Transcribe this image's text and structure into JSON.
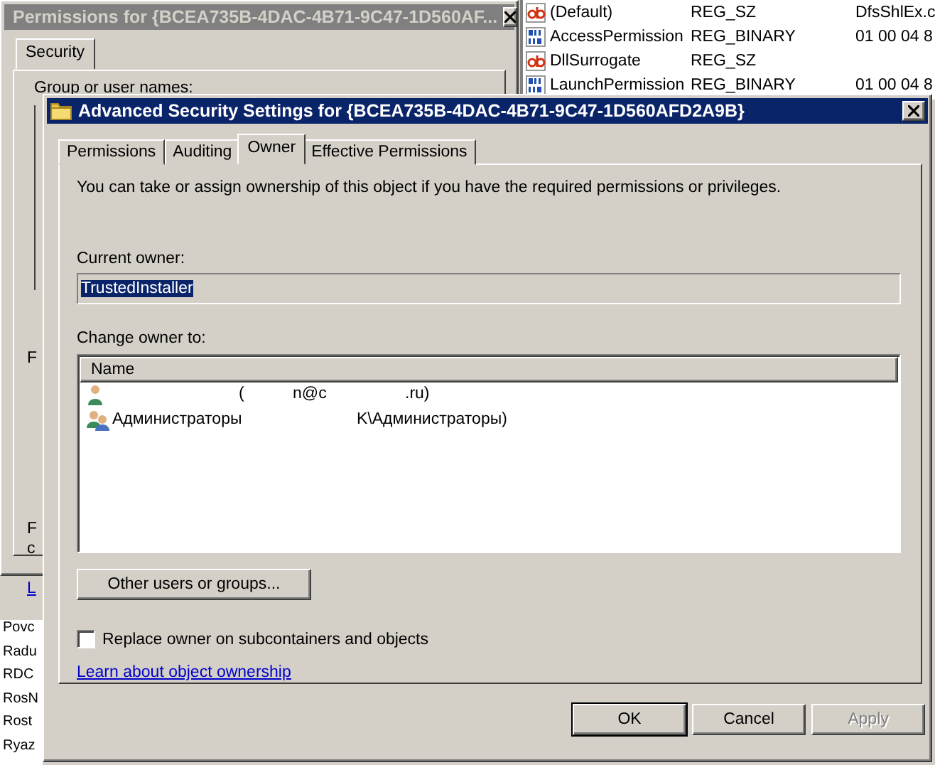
{
  "permissions_window": {
    "title": "Permissions for {BCEA735B-4DAC-4B71-9C47-1D560AF...",
    "tabs": [
      {
        "label": "Security",
        "selected": true
      }
    ],
    "group_label": "Group or user names:",
    "fragments": [
      {
        "kind": "text",
        "text": "F"
      },
      {
        "kind": "text",
        "text": "F"
      },
      {
        "kind": "text",
        "text": "c"
      },
      {
        "kind": "link",
        "text": "L"
      }
    ]
  },
  "registry_values": [
    {
      "kind": "string",
      "name": "(Default)",
      "type": "REG_SZ",
      "data": "DfsShlEx.c"
    },
    {
      "kind": "binary",
      "name": "AccessPermission",
      "type": "REG_BINARY",
      "data": "01 00 04 8"
    },
    {
      "kind": "string",
      "name": "DllSurrogate",
      "type": "REG_SZ"
    },
    {
      "kind": "binary",
      "name": "LaunchPermission",
      "type": "REG_BINARY",
      "data": "01 00 04 8"
    }
  ],
  "tree_items": [
    "Povc",
    "Radu",
    "RDC",
    "RosN",
    "Rost",
    "Ryaz"
  ],
  "dialog": {
    "title": "Advanced Security Settings for {BCEA735B-4DAC-4B71-9C47-1D560AFD2A9B}",
    "tabs": [
      {
        "label": "Permissions",
        "selected": false
      },
      {
        "label": "Auditing",
        "selected": false
      },
      {
        "label": "Owner",
        "selected": true
      },
      {
        "label": "Effective Permissions",
        "selected": false
      }
    ],
    "intro": "You can take or assign ownership of this object if you have the required permissions or privileges.",
    "current_owner_label": "Current owner:",
    "current_owner": {
      "value": "TrustedInstaller",
      "selected": true
    },
    "change_owner_label": "Change owner to:",
    "list_column": "Name",
    "owners": [
      {
        "kind": "user",
        "parts": [
          "(",
          "n@c",
          ".ru)"
        ]
      },
      {
        "kind": "group",
        "parts": [
          "Администраторы",
          "K\\Администраторы)"
        ]
      }
    ],
    "other_button": "Other users or groups...",
    "replace_checkbox": {
      "label": "Replace owner on subcontainers and objects",
      "checked": false
    },
    "link": "Learn about object ownership",
    "buttons": [
      {
        "label": "OK",
        "default": true,
        "disabled": false
      },
      {
        "label": "Cancel",
        "default": false,
        "disabled": false
      },
      {
        "label": "Apply",
        "default": false,
        "disabled": true
      }
    ]
  }
}
